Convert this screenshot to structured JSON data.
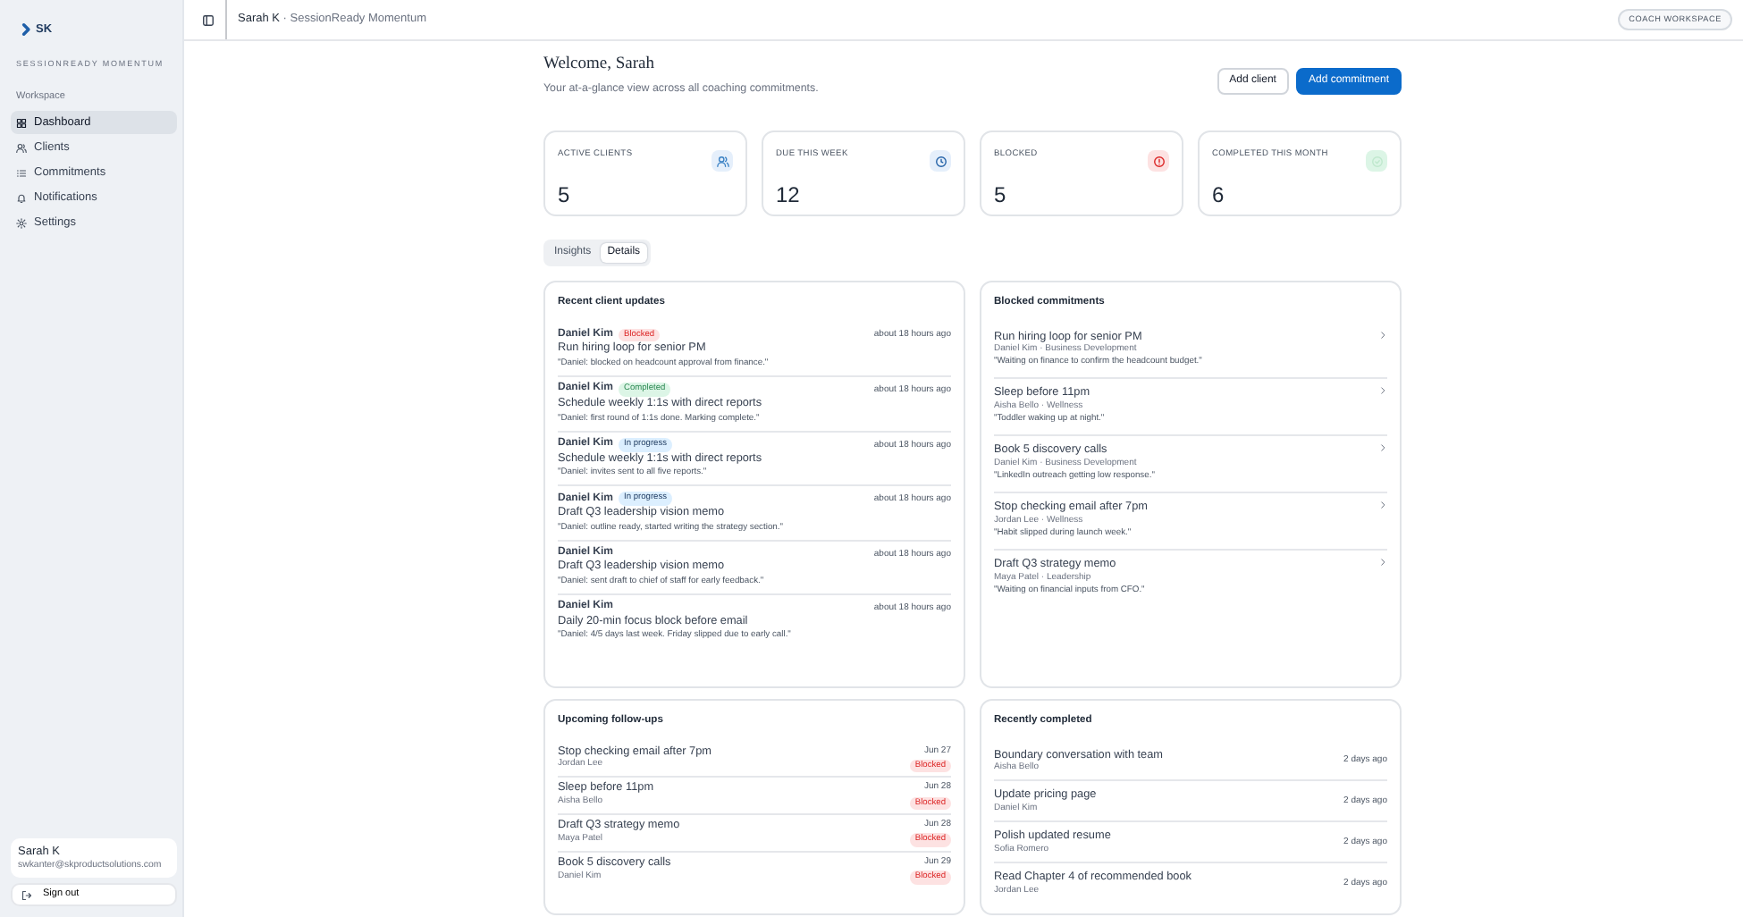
{
  "sidebar": {
    "logo": "SK",
    "brand": "SESSIONREADY MOMENTUM",
    "section": "Workspace",
    "items": [
      {
        "label": "Dashboard",
        "selected": true
      },
      {
        "label": "Clients",
        "selected": false
      },
      {
        "label": "Commitments",
        "selected": false
      },
      {
        "label": "Notifications",
        "selected": false
      },
      {
        "label": "Settings",
        "selected": false
      }
    ],
    "user": {
      "name": "Sarah K",
      "email": "swkanter@skproductsolutions.com"
    },
    "signout": "Sign out"
  },
  "topbar": {
    "user": "Sarah K",
    "separator": "·",
    "app": "SessionReady Momentum",
    "badge": "COACH WORKSPACE"
  },
  "header": {
    "title": "Welcome, Sarah",
    "subtitle": "Your at-a-glance view across all coaching commitments.",
    "buttons": [
      {
        "label": "Add client",
        "kind": "secondary"
      },
      {
        "label": "Add commitment",
        "kind": "primary"
      }
    ]
  },
  "stats": [
    {
      "label": "ACTIVE CLIENTS",
      "value": "5",
      "kind": "clients"
    },
    {
      "label": "DUE THIS WEEK",
      "value": "12",
      "kind": "due"
    },
    {
      "label": "BLOCKED",
      "value": "5",
      "kind": "blocked"
    },
    {
      "label": "COMPLETED THIS MONTH",
      "value": "6",
      "kind": "completed"
    }
  ],
  "tabs": [
    {
      "label": "Insights",
      "selected": false
    },
    {
      "label": "Details",
      "selected": true
    }
  ],
  "recent_updates": {
    "title": "Recent client updates",
    "items": [
      {
        "client": "Daniel Kim",
        "kind": "blocked",
        "badge": "Blocked",
        "time": "about 18 hours ago",
        "commitment": "Run hiring loop for senior PM",
        "note": "\"Daniel: blocked on headcount approval from finance.\""
      },
      {
        "client": "Daniel Kim",
        "kind": "completed",
        "badge": "Completed",
        "time": "about 18 hours ago",
        "commitment": "Schedule weekly 1:1s with direct reports",
        "note": "\"Daniel: first round of 1:1s done. Marking complete.\""
      },
      {
        "client": "Daniel Kim",
        "kind": "in_progress",
        "badge": "In progress",
        "time": "about 18 hours ago",
        "commitment": "Schedule weekly 1:1s with direct reports",
        "note": "\"Daniel: invites sent to all five reports.\""
      },
      {
        "client": "Daniel Kim",
        "kind": "in_progress",
        "badge": "In progress",
        "time": "about 18 hours ago",
        "commitment": "Draft Q3 leadership vision memo",
        "note": "\"Daniel: outline ready, started writing the strategy section.\""
      },
      {
        "client": "Daniel Kim",
        "time": "about 18 hours ago",
        "commitment": "Draft Q3 leadership vision memo",
        "note": "\"Daniel: sent draft to chief of staff for early feedback.\""
      },
      {
        "client": "Daniel Kim",
        "time": "about 18 hours ago",
        "commitment": "Daily 20-min focus block before email",
        "note": "\"Daniel: 4/5 days last week. Friday slipped due to early call.\""
      }
    ]
  },
  "blocked": {
    "title": "Blocked commitments",
    "items": [
      {
        "title": "Run hiring loop for senior PM",
        "meta": "Daniel Kim · Business Development",
        "note": "\"Waiting on finance to confirm the headcount budget.\""
      },
      {
        "title": "Sleep before 11pm",
        "meta": "Aisha Bello · Wellness",
        "note": "\"Toddler waking up at night.\""
      },
      {
        "title": "Book 5 discovery calls",
        "meta": "Daniel Kim · Business Development",
        "note": "\"LinkedIn outreach getting low response.\""
      },
      {
        "title": "Stop checking email after 7pm",
        "meta": "Jordan Lee · Wellness",
        "note": "\"Habit slipped during launch week.\""
      },
      {
        "title": "Draft Q3 strategy memo",
        "meta": "Maya Patel · Leadership",
        "note": "\"Waiting on financial inputs from CFO.\""
      }
    ]
  },
  "followups": {
    "title": "Upcoming follow-ups",
    "items": [
      {
        "title": "Stop checking email after 7pm",
        "client": "Jordan Lee",
        "date": "Jun 27",
        "badge": "Blocked",
        "kind": "blocked"
      },
      {
        "title": "Sleep before 11pm",
        "client": "Aisha Bello",
        "date": "Jun 28",
        "badge": "Blocked",
        "kind": "blocked"
      },
      {
        "title": "Draft Q3 strategy memo",
        "client": "Maya Patel",
        "date": "Jun 28",
        "badge": "Blocked",
        "kind": "blocked"
      },
      {
        "title": "Book 5 discovery calls",
        "client": "Daniel Kim",
        "date": "Jun 29",
        "badge": "Blocked",
        "kind": "blocked"
      }
    ]
  },
  "completed": {
    "title": "Recently completed",
    "items": [
      {
        "title": "Boundary conversation with team",
        "client": "Aisha Bello",
        "time": "2 days ago"
      },
      {
        "title": "Update pricing page",
        "client": "Daniel Kim",
        "time": "2 days ago"
      },
      {
        "title": "Polish updated resume",
        "client": "Sofia Romero",
        "time": "2 days ago"
      },
      {
        "title": "Read Chapter 4 of recommended book",
        "client": "Jordan Lee",
        "time": "2 days ago"
      }
    ]
  }
}
